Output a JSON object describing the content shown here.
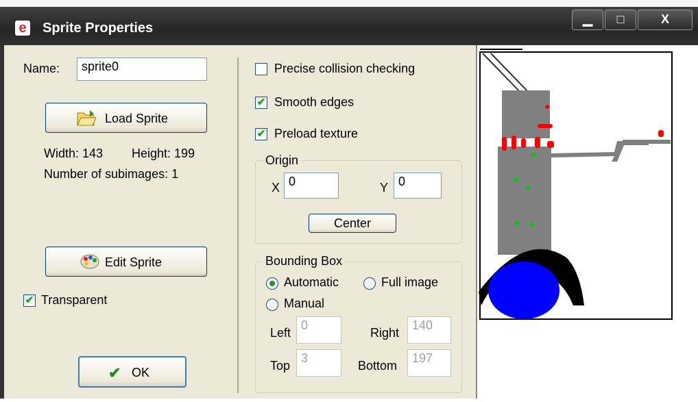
{
  "window": {
    "title": "Sprite Properties",
    "app_icon_glyph": "e",
    "minimize_glyph": "▁",
    "maximize_glyph": "□",
    "close_glyph": "X"
  },
  "left_panel": {
    "name_label": "Name:",
    "name_value": "sprite0",
    "load_sprite_label": "Load Sprite",
    "width_text": "Width: 143",
    "height_text": "Height: 199",
    "subimages_text": "Number of subimages: 1",
    "edit_sprite_label": "Edit Sprite",
    "transparent_label": "Transparent",
    "transparent_checked": true,
    "ok_label": "OK"
  },
  "options": {
    "precise_label": "Precise collision checking",
    "precise_checked": false,
    "smooth_label": "Smooth edges",
    "smooth_checked": true,
    "preload_label": "Preload texture",
    "preload_checked": true
  },
  "origin": {
    "title": "Origin",
    "x_label": "X",
    "x_value": "0",
    "y_label": "Y",
    "y_value": "0",
    "center_label": "Center"
  },
  "bounding_box": {
    "title": "Bounding Box",
    "automatic_label": "Automatic",
    "full_image_label": "Full image",
    "manual_label": "Manual",
    "selected": "Automatic",
    "left_label": "Left",
    "left_value": "0",
    "right_label": "Right",
    "right_value": "140",
    "top_label": "Top",
    "top_value": "3",
    "bottom_label": "Bottom",
    "bottom_value": "197"
  },
  "colors": {
    "sprite_body": "#808080",
    "sprite_dots_red": "#ff0000",
    "sprite_dots_green": "#00cc00",
    "sprite_ball": "#0000ff",
    "sprite_arc": "#000000"
  },
  "icons": {
    "load": "folder-open-icon",
    "edit": "palette-icon",
    "ok": "checkmark-icon"
  }
}
